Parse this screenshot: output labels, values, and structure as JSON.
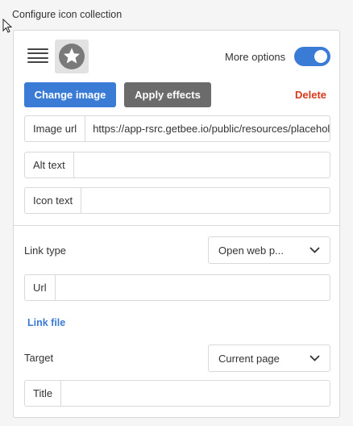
{
  "header": {
    "title": "Configure icon collection"
  },
  "image_row": {
    "more_options_label": "More options",
    "more_options_enabled": true
  },
  "buttons": {
    "change_image": "Change image",
    "apply_effects": "Apply effects",
    "delete": "Delete"
  },
  "fields": {
    "image_url": {
      "label": "Image url",
      "value": "https://app-rsrc.getbee.io/public/resources/placeholders/custom-icon-placeholder.png"
    },
    "alt_text": {
      "label": "Alt text",
      "value": ""
    },
    "icon_text": {
      "label": "Icon text",
      "value": ""
    }
  },
  "link": {
    "type_label": "Link type",
    "type_value": "Open web p...",
    "url_label": "Url",
    "url_value": "",
    "link_file": "Link file",
    "target_label": "Target",
    "target_value": "Current page",
    "title_label": "Title",
    "title_value": ""
  },
  "colors": {
    "accent": "#3a7bd5",
    "secondary_button": "#6b6b6b",
    "danger": "#d63a1a"
  },
  "icons": [
    "cursor-icon",
    "hamburger-icon",
    "star-icon",
    "chevron-down-icon"
  ]
}
